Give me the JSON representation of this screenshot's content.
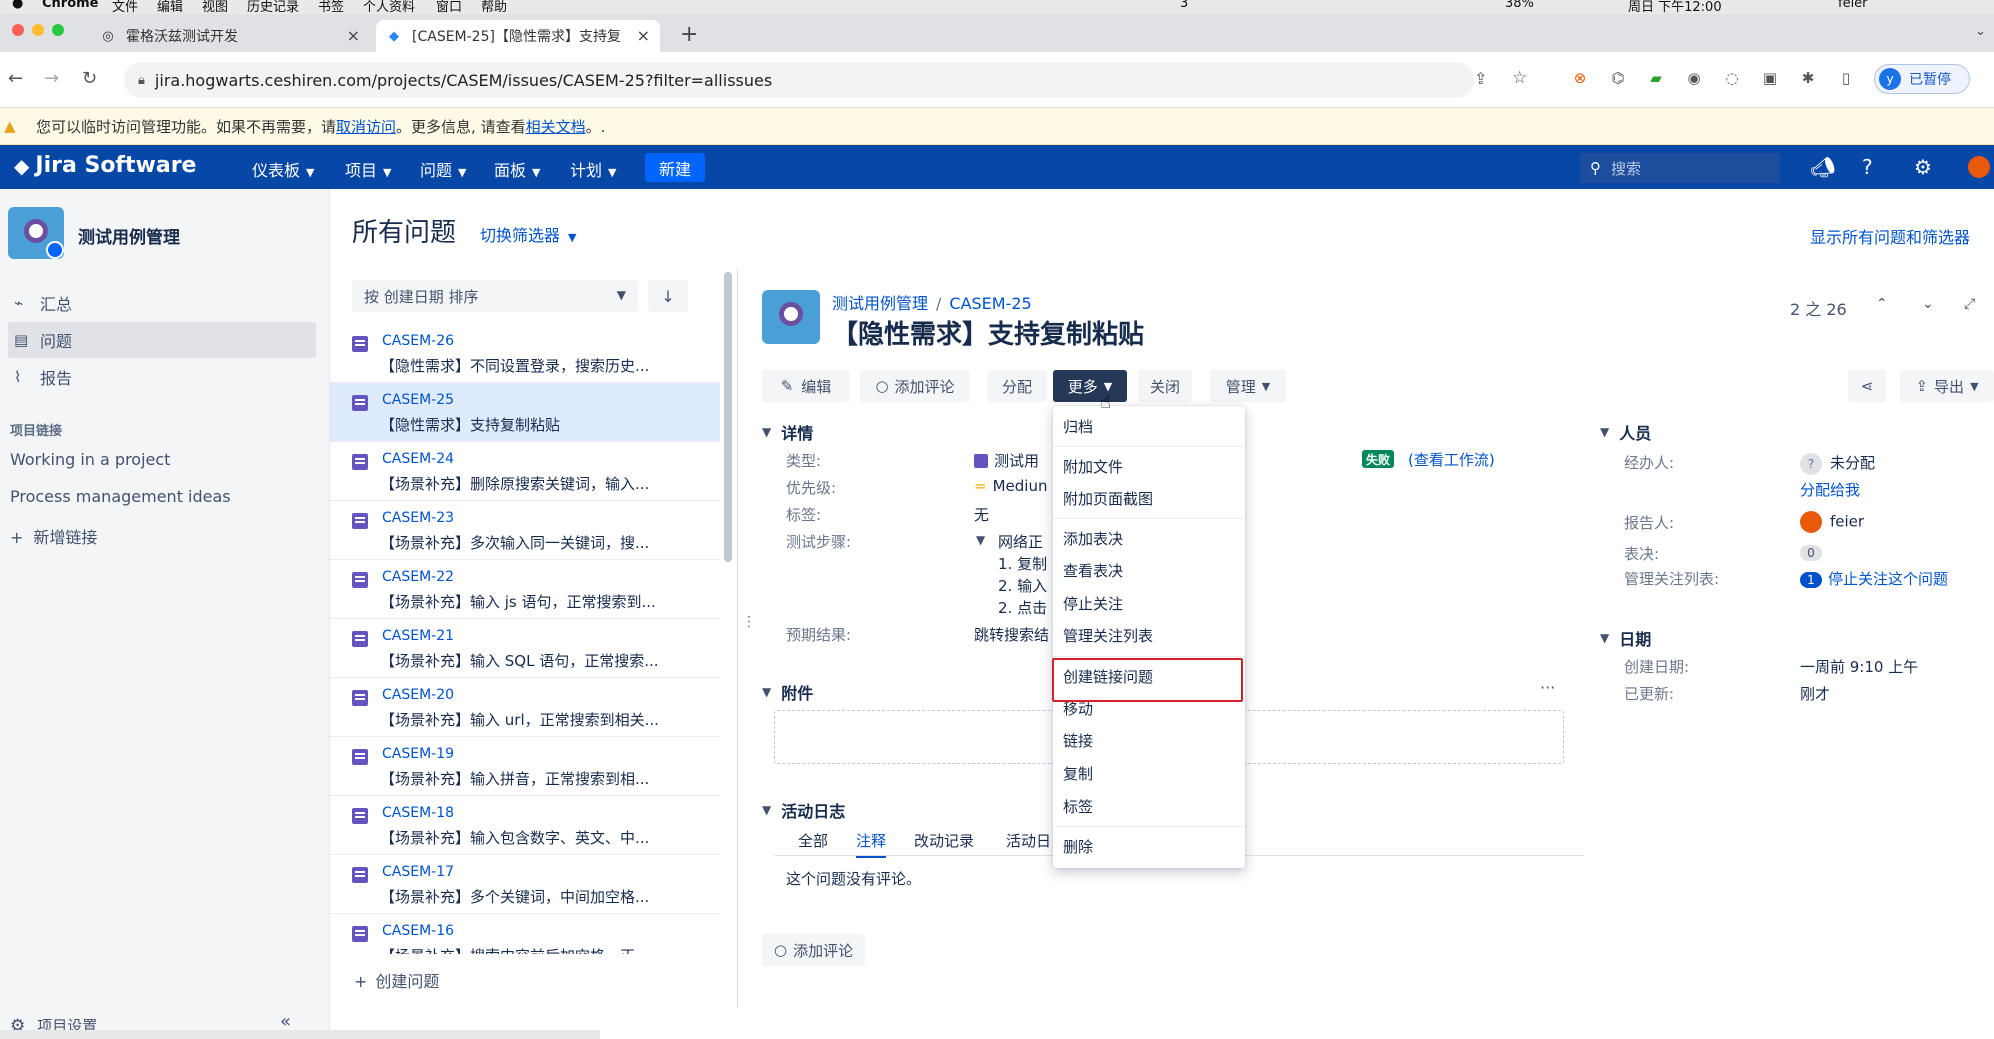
{
  "macbar": {
    "app": "Chrome",
    "menus": [
      "文件",
      "编辑",
      "视图",
      "历史记录",
      "书签",
      "个人资料",
      "窗口",
      "帮助"
    ],
    "battery": "38%",
    "clock": "周日 下午12:00",
    "user": "feier",
    "wechat_count": "3"
  },
  "browser": {
    "tabs": [
      {
        "title": "霍格沃兹测试开发"
      },
      {
        "title": "[CASEM-25]【隐性需求】支持复"
      }
    ],
    "url": "jira.hogwarts.ceshiren.com/projects/CASEM/issues/CASEM-25?filter=allissues",
    "profile_label": "已暂停",
    "profile_initial": "y"
  },
  "banner": {
    "text_before": "您可以临时访问管理功能。如果不再需要，请",
    "link1": "取消访问",
    "text_middle": "。更多信息, 请查看",
    "link2": "相关文档",
    "text_after": "。."
  },
  "topnav": {
    "logo": "Jira Software",
    "items": [
      "仪表板",
      "项目",
      "问题",
      "面板",
      "计划"
    ],
    "create": "新建",
    "search_placeholder": "搜索"
  },
  "sidebar": {
    "project_name": "测试用例管理",
    "items": [
      {
        "label": "汇总",
        "icon": "activity-icon"
      },
      {
        "label": "问题",
        "icon": "issues-icon"
      },
      {
        "label": "报告",
        "icon": "chart-icon"
      }
    ],
    "links_heading": "项目链接",
    "links": [
      "Working in a project",
      "Process management ideas"
    ],
    "add_link": "新增链接",
    "settings": "项目设置"
  },
  "page": {
    "title": "所有问题",
    "switch_filter": "切换筛选器",
    "show_all": "显示所有问题和筛选器"
  },
  "list": {
    "sort_label": "按 创建日期 排序",
    "create_issue": "创建问题",
    "issues": [
      {
        "key": "CASEM-26",
        "title": "【隐性需求】不同设置登录，搜索历史..."
      },
      {
        "key": "CASEM-25",
        "title": "【隐性需求】支持复制粘贴"
      },
      {
        "key": "CASEM-24",
        "title": "【场景补充】删除原搜索关键词，输入..."
      },
      {
        "key": "CASEM-23",
        "title": "【场景补充】多次输入同一关键词，搜..."
      },
      {
        "key": "CASEM-22",
        "title": "【场景补充】输入 js 语句，正常搜索到..."
      },
      {
        "key": "CASEM-21",
        "title": "【场景补充】输入 SQL 语句，正常搜索..."
      },
      {
        "key": "CASEM-20",
        "title": "【场景补充】输入 url，正常搜索到相关..."
      },
      {
        "key": "CASEM-19",
        "title": "【场景补充】输入拼音，正常搜索到相..."
      },
      {
        "key": "CASEM-18",
        "title": "【场景补充】输入包含数字、英文、中..."
      },
      {
        "key": "CASEM-17",
        "title": "【场景补充】多个关键词，中间加空格..."
      },
      {
        "key": "CASEM-16",
        "title": "【场景补充】搜索内容前后加空格，正..."
      }
    ]
  },
  "issue": {
    "project": "测试用例管理",
    "key": "CASEM-25",
    "title": "【隐性需求】支持复制粘贴",
    "pager": "2 之 26",
    "toolbar": {
      "edit": "编辑",
      "comment": "添加评论",
      "assign": "分配",
      "more": "更多",
      "close": "关闭",
      "admin": "管理",
      "export": "导出"
    },
    "details_heading": "详情",
    "fields": {
      "type_label": "类型:",
      "type_value": "测试用",
      "priority_label": "优先级:",
      "priority_value": "Mediun",
      "labels_label": "标签:",
      "labels_value": "无",
      "steps_label": "测试步骤:",
      "steps_lines": [
        "网络正",
        "1. 复制",
        "2. 输入",
        "2. 点击"
      ],
      "expected_label": "预期结果:",
      "expected_value": "跳转搜索结"
    },
    "status": "失败",
    "workflow": "(查看工作流)",
    "attachments_heading": "附件",
    "activity_heading": "活动日志",
    "activity_tabs": [
      "全部",
      "注释",
      "改动记录",
      "活动日"
    ],
    "no_comments": "这个问题没有评论。",
    "add_comment": "添加评论",
    "people_heading": "人员",
    "assignee_label": "经办人:",
    "assignee_value": "未分配",
    "assign_to_me": "分配给我",
    "reporter_label": "报告人:",
    "reporter_value": "feier",
    "votes_label": "表决:",
    "votes_value": "0",
    "watchers_label": "管理关注列表:",
    "watchers_count": "1",
    "stop_watch": "停止关注这个问题",
    "dates_heading": "日期",
    "created_label": "创建日期:",
    "created_value": "一周前 9:10 上午",
    "updated_label": "已更新:",
    "updated_value": "刚才"
  },
  "more_menu": {
    "items": [
      "归档",
      "附加文件",
      "附加页面截图",
      "添加表决",
      "查看表决",
      "停止关注",
      "管理关注列表",
      "创建链接问题",
      "移动",
      "链接",
      "复制",
      "标签",
      "删除"
    ]
  },
  "colors": {
    "jira_nav": "#0747a6",
    "accent": "#0052cc",
    "status_fail": "#00875a",
    "highlight": "#d9202a"
  }
}
